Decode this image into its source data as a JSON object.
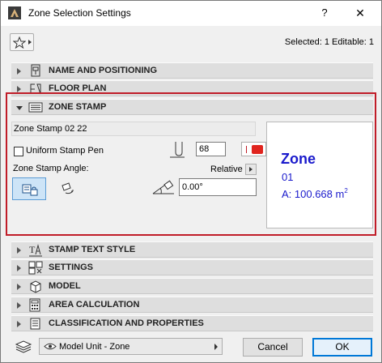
{
  "window": {
    "title": "Zone Selection Settings",
    "help_label": "?",
    "close_label": "✕"
  },
  "toolbar": {
    "selected_info": "Selected: 1 Editable: 1"
  },
  "panels": [
    {
      "label": "NAME AND POSITIONING",
      "expanded": false,
      "icon": "name-position-icon"
    },
    {
      "label": "FLOOR PLAN",
      "expanded": false,
      "icon": "floor-plan-icon"
    },
    {
      "label": "ZONE STAMP",
      "expanded": true,
      "icon": "zone-stamp-icon"
    },
    {
      "label": "STAMP TEXT STYLE",
      "expanded": false,
      "icon": "text-style-icon"
    },
    {
      "label": "SETTINGS",
      "expanded": false,
      "icon": "settings-icon"
    },
    {
      "label": "MODEL",
      "expanded": false,
      "icon": "model-icon"
    },
    {
      "label": "AREA CALCULATION",
      "expanded": false,
      "icon": "area-calculation-icon"
    },
    {
      "label": "CLASSIFICATION AND PROPERTIES",
      "expanded": false,
      "icon": "classification-icon"
    }
  ],
  "zone_stamp": {
    "stamp_name": "Zone Stamp 02 22",
    "uniform_pen_label": "Uniform Stamp Pen",
    "uniform_pen_checked": false,
    "pen_value": "68",
    "pen_color": "#e0241e",
    "angle_label": "Zone Stamp Angle:",
    "relative_label": "Relative",
    "angle_value": "0.00°",
    "preview": {
      "title": "Zone",
      "number": "01",
      "area": "A: 100.668 m",
      "area_unit_sup": "2",
      "text_color": "#1a1acc"
    }
  },
  "bottom": {
    "layer_value": "Model Unit - Zone",
    "cancel_label": "Cancel",
    "ok_label": "OK"
  },
  "colors": {
    "highlight": "#c01c28",
    "accent": "#0078d7"
  }
}
